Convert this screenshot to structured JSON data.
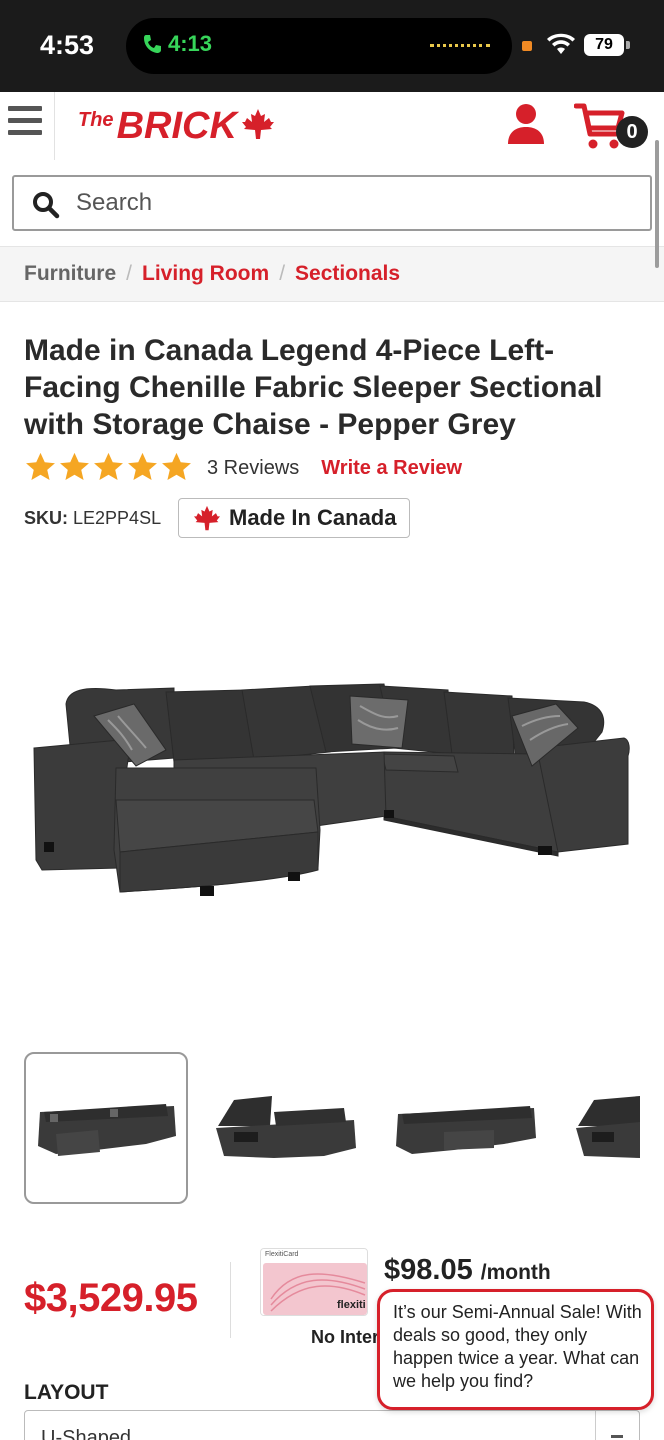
{
  "status_bar": {
    "time": "4:53",
    "call_time": "4:13",
    "battery": "79"
  },
  "header": {
    "logo_the": "The",
    "logo_brick": "BRICK",
    "cart_count": "0"
  },
  "search": {
    "placeholder": "Search"
  },
  "breadcrumb": {
    "items": [
      "Furniture",
      "Living Room",
      "Sectionals"
    ],
    "separator": "/"
  },
  "product": {
    "title": "Made in Canada Legend 4-Piece Left-Facing Chenille Fabric Sleeper Sectional with Storage Chaise - Pepper Grey",
    "rating": 5,
    "reviews_label": "3 Reviews",
    "write_review": "Write a Review",
    "sku_label": "SKU:",
    "sku_value": "LE2PP4SL",
    "made_in_canada": "Made In Canada",
    "price": "$3,529.95",
    "monthly_amount": "$98.05",
    "monthly_suffix": "/month",
    "no_interest": "No Interest",
    "flexiti_card_label": "FlexitiCard",
    "flexiti_brand": "flexiti",
    "layout_label": "LAYOUT",
    "layout_value": "U-Shaped"
  },
  "chat": {
    "message": "It’s our Semi-Annual Sale! With deals so good, they only happen twice a year. What can we help you find?"
  },
  "colors": {
    "brand_red": "#d6202a",
    "star_yellow": "#f5a623",
    "sofa_grey": "#3a3a3a"
  },
  "icons": [
    "hamburger-menu-icon",
    "maple-leaf-icon",
    "account-icon",
    "cart-icon",
    "search-icon",
    "star-icon",
    "phone-icon",
    "wifi-icon"
  ]
}
